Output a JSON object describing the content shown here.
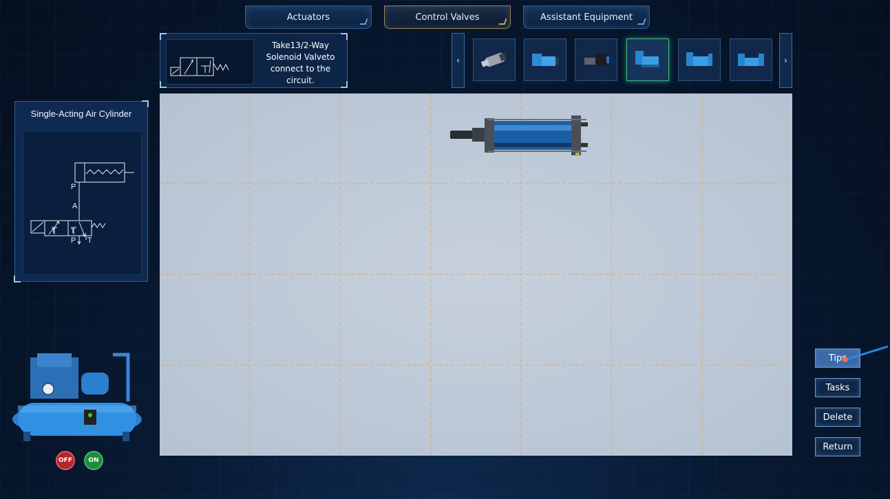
{
  "tabs": [
    {
      "label": "Actuators",
      "active": false
    },
    {
      "label": "Control Valves",
      "active": true
    },
    {
      "label": "Assistant Equipment",
      "active": false
    }
  ],
  "instruction": {
    "text": "Take13/2-Way Solenoid Valveto connect to the circuit."
  },
  "component_strip": {
    "prev_icon": "chevron-left-icon",
    "next_icon": "chevron-right-icon",
    "items": [
      {
        "name": "valve-grey",
        "active": false
      },
      {
        "name": "valve-blue-1",
        "active": false
      },
      {
        "name": "valve-dark",
        "active": false
      },
      {
        "name": "3-2-way-solenoid-valve",
        "active": true
      },
      {
        "name": "valve-blue-2",
        "active": false
      },
      {
        "name": "valve-blue-3",
        "active": false
      }
    ]
  },
  "symbol_panel": {
    "title": "Single-Acting Air Cylinder",
    "labels": {
      "p_top": "P",
      "a": "A",
      "t1": "T",
      "t2": "T",
      "p_bottom": "P",
      "t_right": "T"
    }
  },
  "canvas": {
    "placed": [
      "air-cylinder"
    ]
  },
  "side_buttons": [
    {
      "label": "Tips",
      "highlight": true
    },
    {
      "label": "Tasks",
      "highlight": false
    },
    {
      "label": "Delete",
      "highlight": false
    },
    {
      "label": "Return",
      "highlight": false
    }
  ],
  "compressor": {
    "off_label": "OFF",
    "on_label": "ON"
  },
  "colors": {
    "accent": "#3fbf88",
    "canvas_bg": "#b9c6d5",
    "grid_line": "#e0a35c",
    "off": "#b3262b",
    "on": "#1f8a3b"
  }
}
